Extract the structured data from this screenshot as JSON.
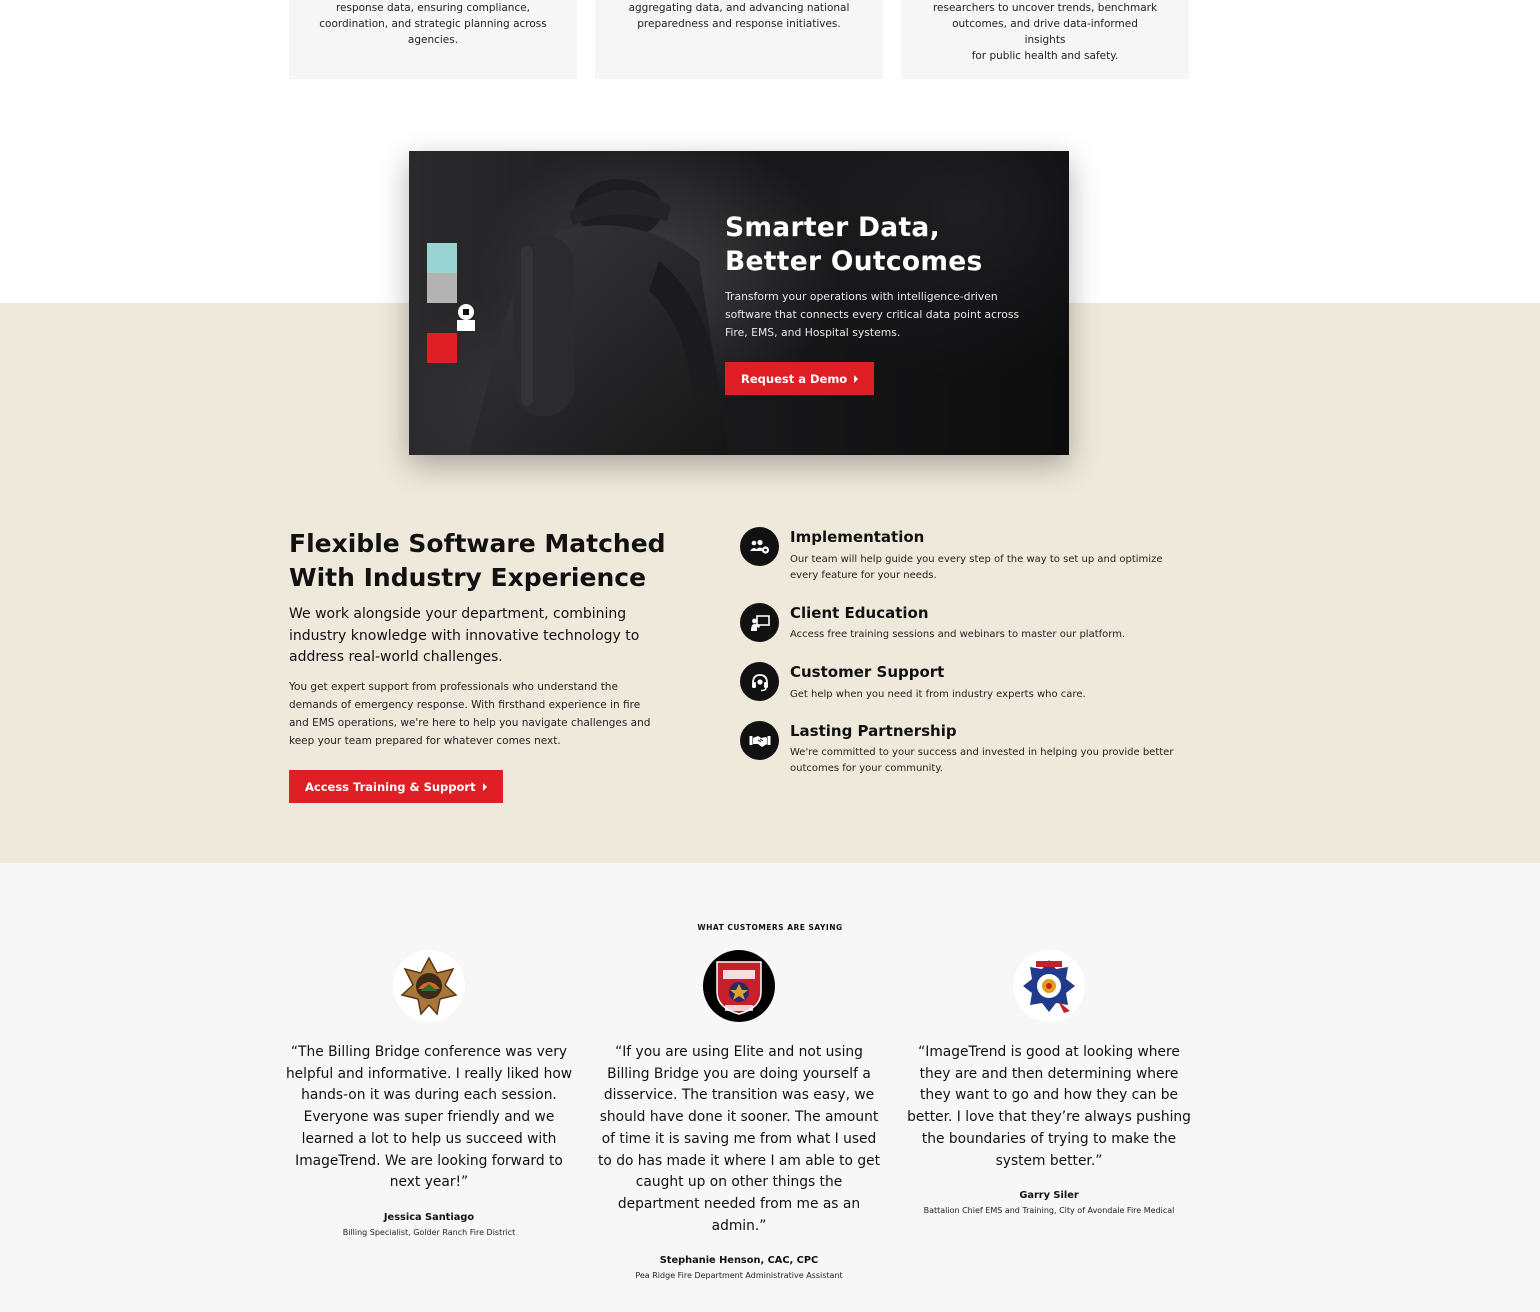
{
  "top_cards": [
    {
      "lines": [
        "response data, ensuring compliance,",
        "coordination, and strategic planning across",
        "agencies."
      ]
    },
    {
      "lines": [
        "aggregating data, and advancing national",
        "preparedness and response initiatives."
      ]
    },
    {
      "lines": [
        "researchers to uncover trends, benchmark",
        "outcomes, and drive data-informed insights",
        "for public health and safety."
      ]
    }
  ],
  "hero": {
    "title": "Smarter Data, Better Outcomes",
    "body": "Transform your operations with intelligence-driven software that connects every critical data point across Fire, EMS, and Hospital systems.",
    "button_label": "Request a Demo",
    "block_colors": [
      "#9ad4d2",
      "#b3b3b3",
      "#e01e26"
    ]
  },
  "flexible": {
    "title": "Flexible Software Matched With Industry Experience",
    "lead": "We work alongside your department, combining industry knowledge with innovative technology to address real-world challenges.",
    "body": "You get expert support from professionals who understand the demands of emergency response. With firsthand experience in fire and EMS operations, we're here to help you navigate challenges and keep your team prepared for whatever comes next.",
    "button_label": "Access Training & Support",
    "features": [
      {
        "icon": "team-gear-icon",
        "title": "Implementation",
        "text": "Our team will help guide you every step of the way to set up and optimize every feature for your needs."
      },
      {
        "icon": "presentation-icon",
        "title": "Client Education",
        "text": "Access free training sessions and webinars to master our platform."
      },
      {
        "icon": "headset-icon",
        "title": "Customer Support",
        "text": "Get help when you need it from industry experts who care."
      },
      {
        "icon": "handshake-icon",
        "title": "Lasting Partnership",
        "text": "We're committed to your success and invested in helping you provide better outcomes for your community."
      }
    ]
  },
  "testimonials": {
    "eyebrow": "WHAT CUSTOMERS ARE SAYING",
    "items": [
      {
        "logo": "golder-ranch-badge-icon",
        "quote": "“The Billing Bridge conference was very helpful and informative. I really liked how hands-on it was during each session. Everyone was super friendly and we learned a lot to help us succeed with ImageTrend. We are looking forward to next year!”",
        "name": "Jessica Santiago",
        "role": "Billing Specialist, Golder Ranch Fire District"
      },
      {
        "logo": "pea-ridge-badge-icon",
        "quote": "“If you are using Elite and not using Billing Bridge you are doing yourself a disservice. The transition was easy, we should have done it sooner. The amount of time it is saving me from what I used to do has made it where I am able to get caught up on other things the department needed from me as an admin.”",
        "name": "Stephanie Henson, CAC, CPC",
        "role": "Pea Ridge Fire Department Administrative Assistant"
      },
      {
        "logo": "avondale-badge-icon",
        "quote": "“ImageTrend is good at looking where they are and then determining where they want to go and how they can be better. I love that they’re always pushing the boundaries of trying to make the system better.”",
        "name": "Garry Siler",
        "role": "Battalion Chief EMS and Training, City of Avondale Fire Medical"
      }
    ]
  }
}
